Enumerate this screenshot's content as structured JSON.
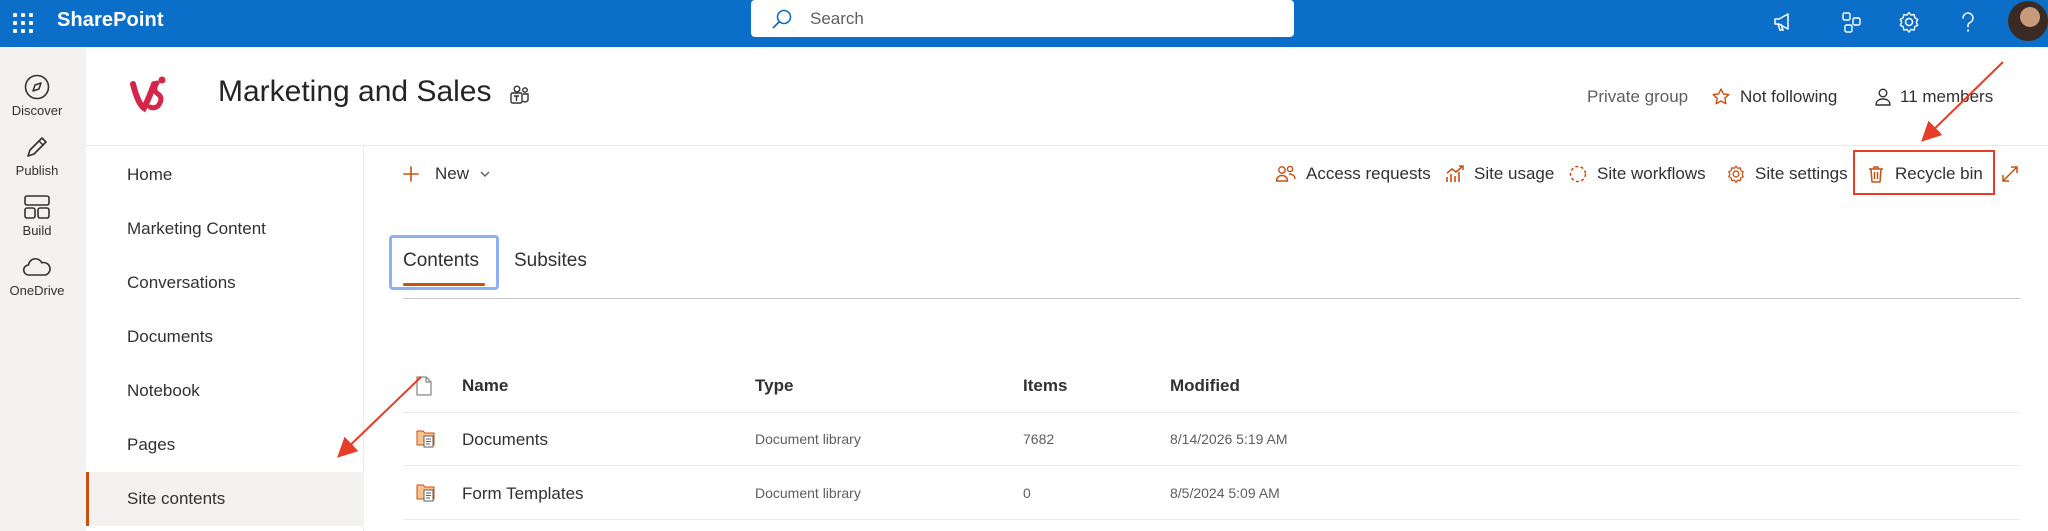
{
  "topbar": {
    "app_name": "SharePoint",
    "search_placeholder": "Search"
  },
  "rail": {
    "items": [
      {
        "label": "Discover",
        "icon": "compass-icon"
      },
      {
        "label": "Publish",
        "icon": "pen-icon"
      },
      {
        "label": "Build",
        "icon": "layout-icon"
      },
      {
        "label": "OneDrive",
        "icon": "cloud-icon"
      }
    ]
  },
  "site": {
    "title": "Marketing and Sales",
    "privacy": "Private group",
    "follow": "Not following",
    "members": "11 members"
  },
  "nav": {
    "items": [
      "Home",
      "Marketing Content",
      "Conversations",
      "Documents",
      "Notebook",
      "Pages",
      "Site contents"
    ],
    "selected": "Site contents"
  },
  "commands": {
    "new_label": "New",
    "access_requests": "Access requests",
    "site_usage": "Site usage",
    "site_workflows": "Site workflows",
    "site_settings": "Site settings",
    "recycle_bin": "Recycle bin"
  },
  "tabs": [
    "Contents",
    "Subsites"
  ],
  "table": {
    "columns": {
      "name": "Name",
      "type": "Type",
      "items": "Items",
      "modified": "Modified"
    },
    "rows": [
      {
        "name": "Documents",
        "type": "Document library",
        "items": "7682",
        "modified": "8/14/2026 5:19 AM"
      },
      {
        "name": "Form Templates",
        "type": "Document library",
        "items": "0",
        "modified": "8/5/2024 5:09 AM"
      }
    ]
  },
  "colors": {
    "suite_bar": "#0b6fc9",
    "accent": "#ca5010",
    "highlight_box": "#e63c28"
  }
}
